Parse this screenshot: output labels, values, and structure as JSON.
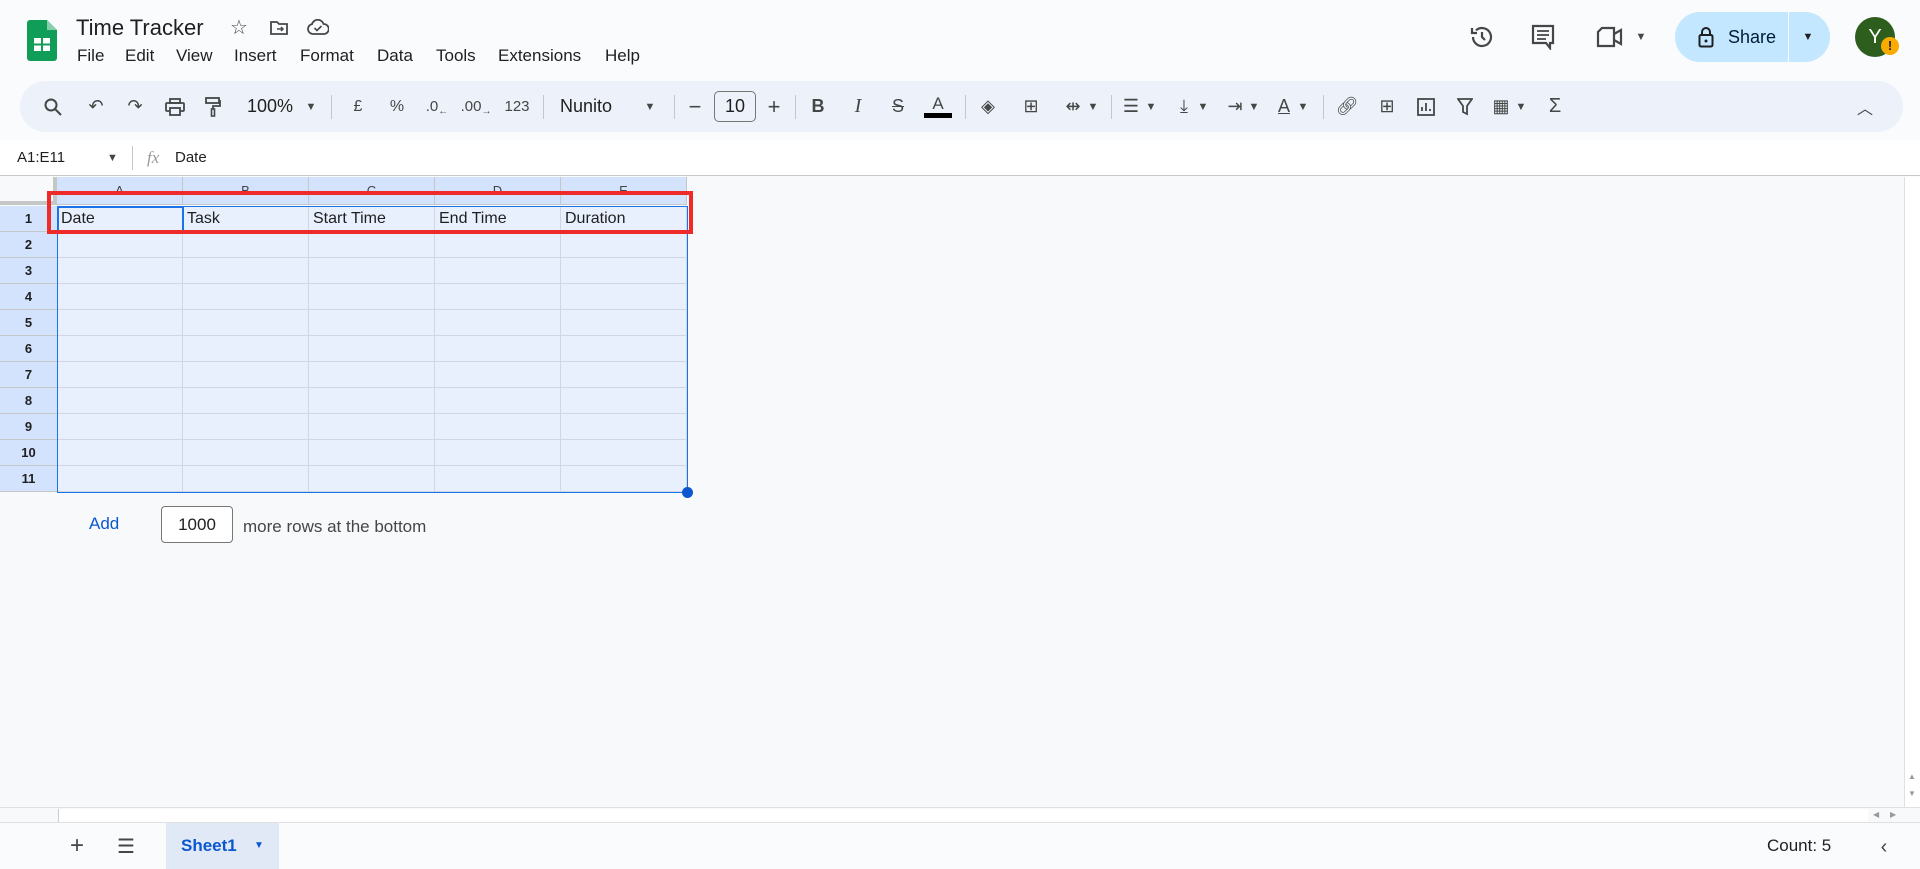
{
  "app": {
    "title": "Time Tracker",
    "logo": "google-sheets-logo",
    "icons": [
      "star-icon",
      "move-to-folder-icon",
      "cloud-saved-icon"
    ]
  },
  "menu": [
    "File",
    "Edit",
    "View",
    "Insert",
    "Format",
    "Data",
    "Tools",
    "Extensions",
    "Help"
  ],
  "header_right": {
    "share_label": "Share",
    "avatar_letter": "Y",
    "accent": "#c2e7ff",
    "avatar_color": "#2d5e1e"
  },
  "toolbar": {
    "zoom": "100%",
    "currency": "£",
    "percent": "%",
    "dec_decrease": ".0",
    "dec_increase": ".00",
    "number_format": "123",
    "font": "Nunito",
    "font_size": "10",
    "bold": "B",
    "italic": "I",
    "text_color": "A",
    "sigma": "Σ"
  },
  "formula_bar": {
    "name_box": "A1:E11",
    "fx": "fx",
    "value": "Date"
  },
  "grid": {
    "columns": [
      "A",
      "B",
      "C",
      "D",
      "E"
    ],
    "rows": [
      "1",
      "2",
      "3",
      "4",
      "5",
      "6",
      "7",
      "8",
      "9",
      "10",
      "11"
    ],
    "header_row": [
      "Date",
      "Task",
      "Start Time",
      "End Time",
      "Duration"
    ],
    "highlight_color": "#ee2a2a"
  },
  "add_rows": {
    "button": "Add",
    "count": "1000",
    "suffix": "more rows at the bottom"
  },
  "bottom": {
    "sheet_tab": "Sheet1",
    "status": "Count: 5"
  }
}
